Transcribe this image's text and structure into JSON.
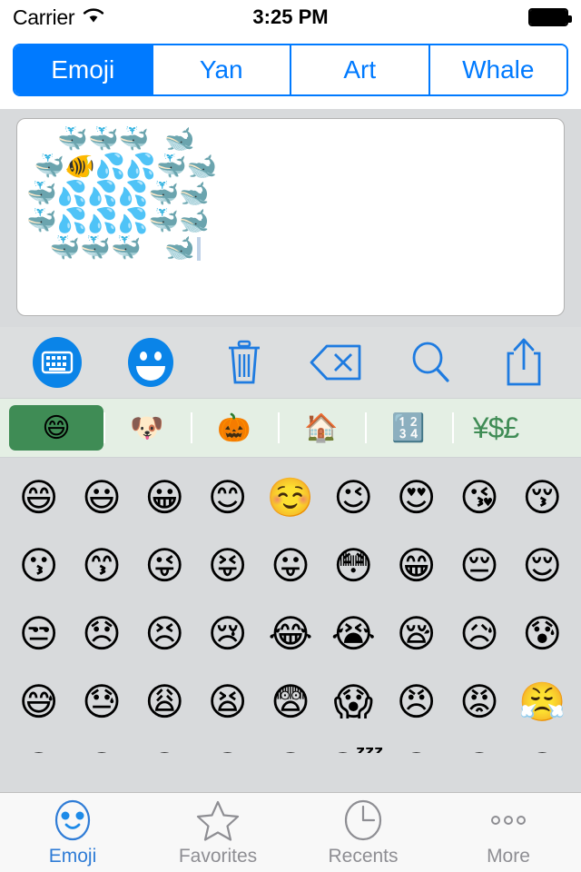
{
  "statusbar": {
    "carrier": "Carrier",
    "wifi_icon": "wifi-icon",
    "time": "3:25 PM",
    "battery_icon": "battery-full-icon"
  },
  "segments": [
    {
      "label": "Emoji",
      "active": true
    },
    {
      "label": "Yan",
      "active": false
    },
    {
      "label": "Art",
      "active": false
    },
    {
      "label": "Whale",
      "active": false
    }
  ],
  "composer": {
    "lines": [
      "    🐳🐳🐳  🐋",
      " 🐳🐠💦💦🐳🐋",
      "🐳💦💦💦🐳🐋",
      "🐳💦💦💦🐳🐋",
      "   🐳🐳🐳   🐋"
    ],
    "caret_visible": true
  },
  "toolbar": [
    {
      "icon": "keyboard-icon",
      "label": "Keyboard"
    },
    {
      "icon": "smiley-icon",
      "label": "Emoji"
    },
    {
      "icon": "trash-icon",
      "label": "Clear"
    },
    {
      "icon": "backspace-icon",
      "label": "Delete"
    },
    {
      "icon": "search-icon",
      "label": "Search"
    },
    {
      "icon": "share-icon",
      "label": "Share"
    }
  ],
  "categories": [
    {
      "glyph": "😄",
      "name": "smileys",
      "active": true
    },
    {
      "glyph": "🐶",
      "name": "animals",
      "active": false
    },
    {
      "glyph": "🎃",
      "name": "objects",
      "active": false
    },
    {
      "glyph": "🏠",
      "name": "places",
      "active": false
    },
    {
      "glyph": "🔢",
      "name": "numbers",
      "active": false
    },
    {
      "glyph": "¥$£",
      "name": "symbols",
      "active": false,
      "text": true
    }
  ],
  "emoji_grid": {
    "rows": [
      [
        "😄",
        "😃",
        "😀",
        "😊",
        "☺️",
        "😉",
        "😍",
        "😘",
        "😚"
      ],
      [
        "😗",
        "😙",
        "😜",
        "😝",
        "😛",
        "😳",
        "😁",
        "😔",
        "😌"
      ],
      [
        "😒",
        "😞",
        "😣",
        "😢",
        "😂",
        "😭",
        "😪",
        "😥",
        "😰"
      ],
      [
        "😅",
        "😓",
        "😩",
        "😫",
        "😨",
        "😱",
        "😠",
        "😡",
        "😤"
      ],
      [
        "😖",
        "😆",
        "😋",
        "😷",
        "😎",
        "😴",
        "😵",
        "😵",
        "🙃"
      ]
    ]
  },
  "tabbar": [
    {
      "label": "Emoji",
      "icon": "emoji-face-icon",
      "active": true
    },
    {
      "label": "Favorites",
      "icon": "star-icon",
      "active": false
    },
    {
      "label": "Recents",
      "icon": "clock-icon",
      "active": false
    },
    {
      "label": "More",
      "icon": "ellipsis-icon",
      "active": false
    }
  ],
  "colors": {
    "accent_blue": "#007AFF",
    "tab_active": "#2F7CD6",
    "category_selected": "#3F8C55",
    "category_bar": "#E4EFE4",
    "background": "#D8DADC"
  }
}
